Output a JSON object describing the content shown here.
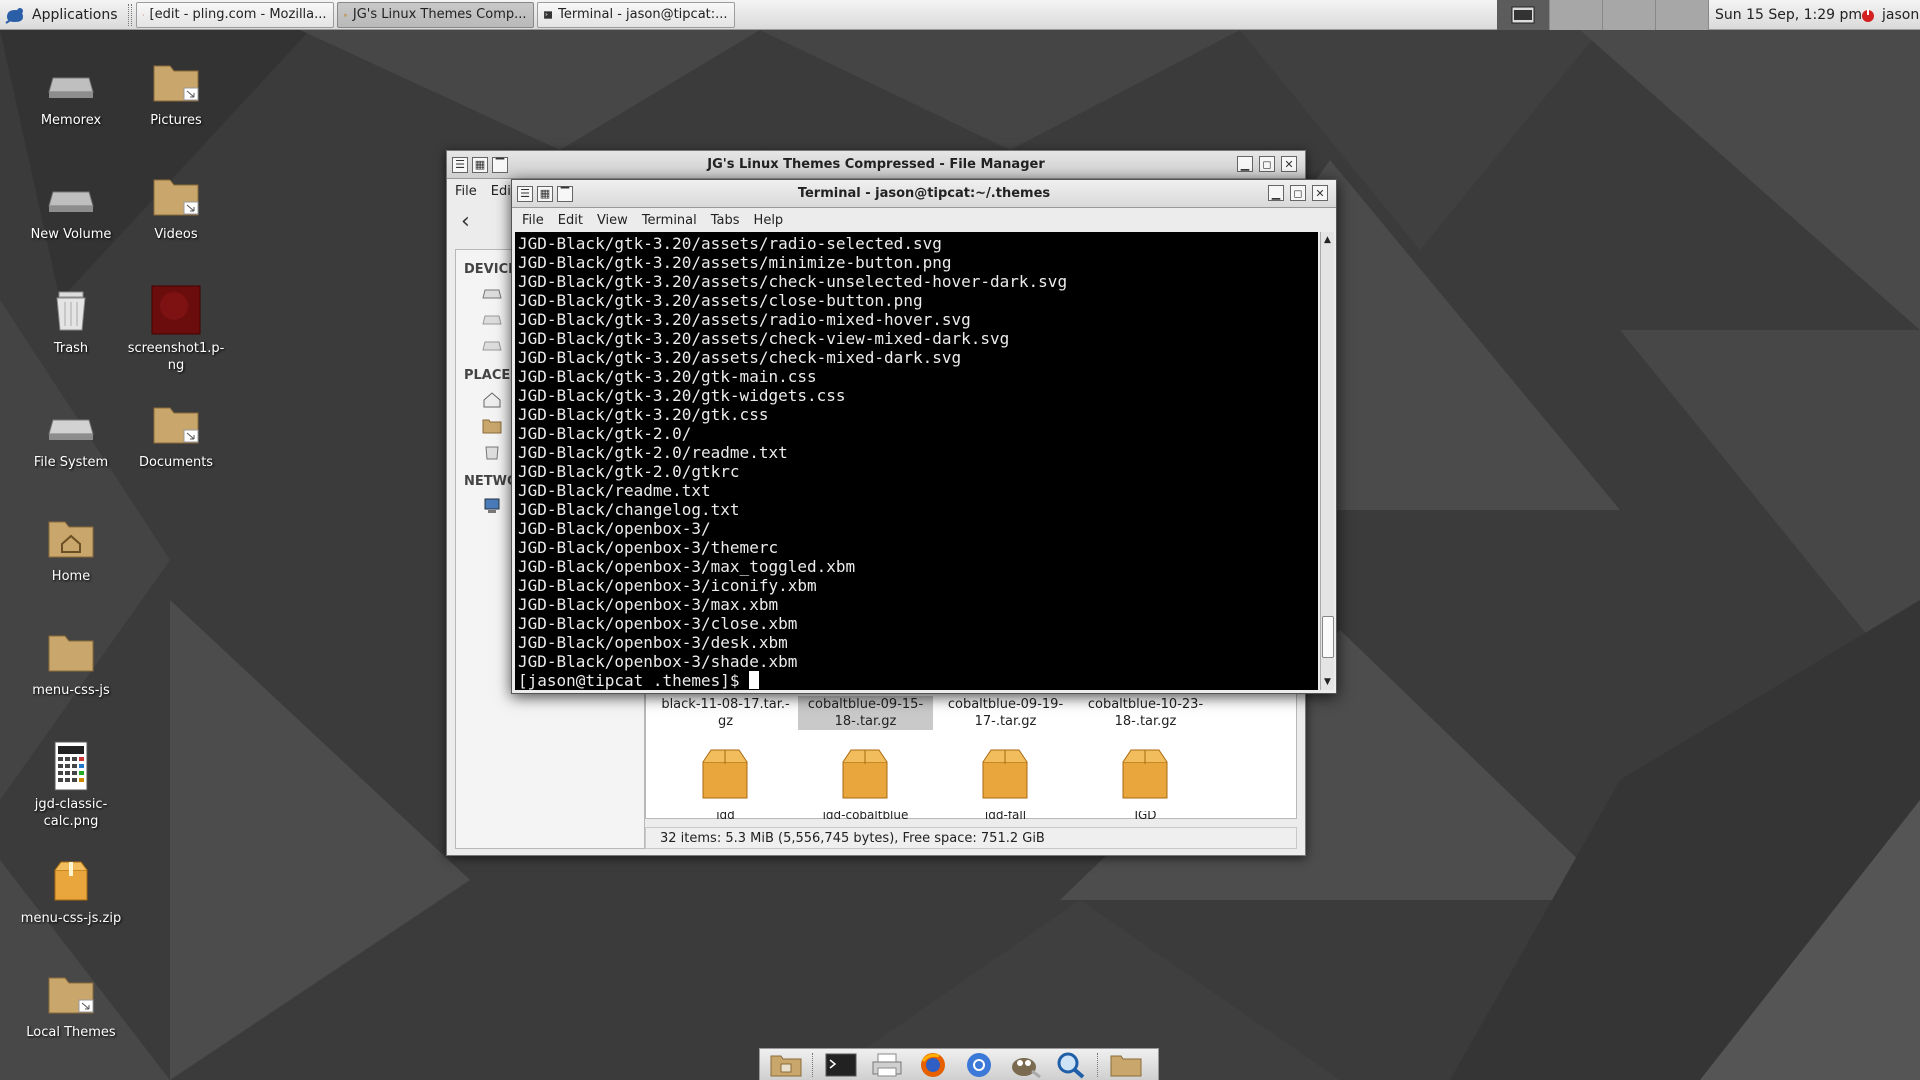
{
  "panel": {
    "applications_label": "Applications",
    "tasks": [
      {
        "label": "[edit - pling.com - Mozilla..."
      },
      {
        "label": "JG's Linux Themes Comp..."
      },
      {
        "label": "Terminal - jason@tipcat:..."
      }
    ],
    "clock": "Sun 15 Sep,  1:29 pm",
    "user": "jason"
  },
  "desktop_icons": [
    {
      "label": "Memorex",
      "icon": "drive-icon"
    },
    {
      "label": "Pictures",
      "icon": "folder-link-icon"
    },
    {
      "label": "New Volume",
      "icon": "drive-icon"
    },
    {
      "label": "Videos",
      "icon": "folder-link-icon"
    },
    {
      "label": "Trash",
      "icon": "trash-icon"
    },
    {
      "label": "screenshot1.p-ng",
      "icon": "image-thumbnail-icon"
    },
    {
      "label": "File System",
      "icon": "drive-icon"
    },
    {
      "label": "Documents",
      "icon": "folder-link-icon"
    },
    {
      "label": "Home",
      "icon": "home-folder-icon"
    },
    {
      "label": "menu-css-js",
      "icon": "folder-icon"
    },
    {
      "label": "jgd-classic-calc.png",
      "icon": "calculator-image-icon"
    },
    {
      "label": "menu-css-js.zip",
      "icon": "archive-icon"
    },
    {
      "label": "Local Themes",
      "icon": "folder-link-icon"
    }
  ],
  "file_manager": {
    "title": "JG's Linux Themes Compressed - File Manager",
    "menu": [
      "File",
      "Edi"
    ],
    "sidebar_headers": [
      "DEVICE",
      "PLACES",
      "NETWO"
    ],
    "files_row1": [
      {
        "label": "black-11-08-17.tar.-gz",
        "selected": false
      },
      {
        "label": "cobaltblue-09-15-18-.tar.gz",
        "selected": true
      },
      {
        "label": "cobaltblue-09-19-17-.tar.gz",
        "selected": false
      },
      {
        "label": "cobaltblue-10-23-18-.tar.gz",
        "selected": false
      }
    ],
    "files_row2": [
      {
        "label": "jgd"
      },
      {
        "label": "jgd-cobaltblue"
      },
      {
        "label": "jgd-fall"
      },
      {
        "label": "JGD"
      }
    ],
    "status": "32 items: 5.3 MiB (5,556,745 bytes), Free space: 751.2 GiB"
  },
  "terminal": {
    "title": "Terminal - jason@tipcat:~/.themes",
    "menu": [
      "File",
      "Edit",
      "View",
      "Terminal",
      "Tabs",
      "Help"
    ],
    "lines": [
      "JGD-Black/gtk-3.20/assets/radio-selected.svg",
      "JGD-Black/gtk-3.20/assets/minimize-button.png",
      "JGD-Black/gtk-3.20/assets/check-unselected-hover-dark.svg",
      "JGD-Black/gtk-3.20/assets/close-button.png",
      "JGD-Black/gtk-3.20/assets/radio-mixed-hover.svg",
      "JGD-Black/gtk-3.20/assets/check-view-mixed-dark.svg",
      "JGD-Black/gtk-3.20/assets/check-mixed-dark.svg",
      "JGD-Black/gtk-3.20/gtk-main.css",
      "JGD-Black/gtk-3.20/gtk-widgets.css",
      "JGD-Black/gtk-3.20/gtk.css",
      "JGD-Black/gtk-2.0/",
      "JGD-Black/gtk-2.0/readme.txt",
      "JGD-Black/gtk-2.0/gtkrc",
      "JGD-Black/readme.txt",
      "JGD-Black/changelog.txt",
      "JGD-Black/openbox-3/",
      "JGD-Black/openbox-3/themerc",
      "JGD-Black/openbox-3/max_toggled.xbm",
      "JGD-Black/openbox-3/iconify.xbm",
      "JGD-Black/openbox-3/max.xbm",
      "JGD-Black/openbox-3/close.xbm",
      "JGD-Black/openbox-3/desk.xbm",
      "JGD-Black/openbox-3/shade.xbm"
    ],
    "prompt": "[jason@tipcat .themes]$ "
  },
  "dock": [
    {
      "icon": "file-manager-icon"
    },
    {
      "icon": "terminal-icon"
    },
    {
      "icon": "printer-icon"
    },
    {
      "icon": "firefox-icon"
    },
    {
      "icon": "chromium-icon"
    },
    {
      "icon": "gimp-icon"
    },
    {
      "icon": "search-icon"
    },
    {
      "icon": "folder-icon"
    }
  ],
  "colors": {
    "terminal_bg": "#000000",
    "terminal_fg": "#ececec",
    "panel_bg": "#e6e6e6",
    "folder": "#d2b48c",
    "package": "#e8a63c"
  }
}
